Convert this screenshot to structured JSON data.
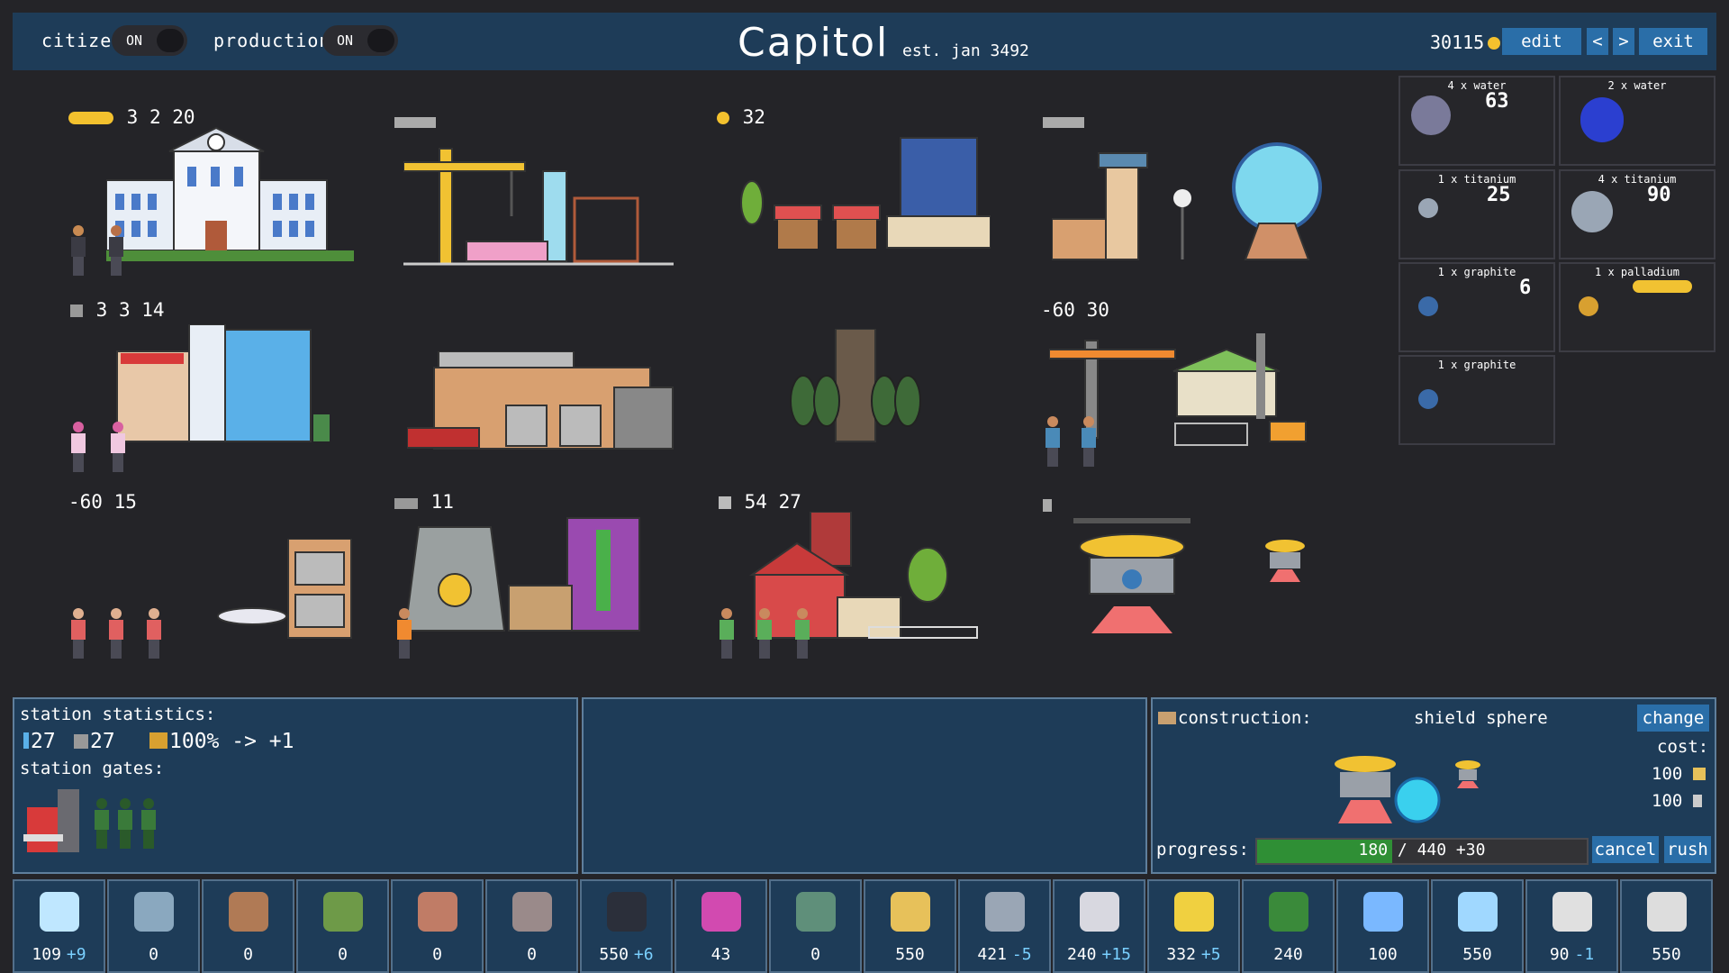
{
  "topbar": {
    "citizen_label": "citizen",
    "citizen_toggle": "ON",
    "production_label": "production",
    "production_toggle": "ON",
    "title": "Capitol",
    "subtitle": "est. jan 3492",
    "coins": "30115",
    "edit_label": "edit",
    "prev_label": "<",
    "next_label": ">",
    "exit_label": "exit"
  },
  "buildings": {
    "capitol_stats": "3  2  20",
    "market_stats": "32",
    "ad_agency_stats": "3  3  14",
    "construction_site_stats": "-60 30",
    "hangar_stats": "-60  15",
    "power_plant_stats": "11",
    "farm_stats": "54 27"
  },
  "resource_cards": [
    {
      "title": "4 x water",
      "value": "63"
    },
    {
      "title": "2 x water",
      "value": ""
    },
    {
      "title": "1 x titanium",
      "value": "25"
    },
    {
      "title": "4 x titanium",
      "value": "90"
    },
    {
      "title": "1 x graphite",
      "value": "6"
    },
    {
      "title": "1 x palladium",
      "value": ""
    },
    {
      "title": "1 x graphite",
      "value": ""
    }
  ],
  "station": {
    "heading": "station statistics:",
    "citizens": "27",
    "housing": "27",
    "approval": "100% -> +1",
    "gates_heading": "station gates:"
  },
  "construction": {
    "label": "construction:",
    "name": "shield sphere",
    "change_label": "change",
    "cost_label": "cost:",
    "cost1": "100",
    "cost2": "100",
    "progress_label": "progress:",
    "progress_text": "180 / 440 +30",
    "progress_fraction": 0.41,
    "cancel_label": "cancel",
    "rush_label": "rush"
  },
  "resources": [
    {
      "name": "water",
      "value": "109",
      "delta": "+9",
      "color": "#bfe7ff"
    },
    {
      "name": "blueprint",
      "value": "0",
      "delta": "",
      "color": "#8aa8bf"
    },
    {
      "name": "ore",
      "value": "0",
      "delta": "",
      "color": "#b07a55"
    },
    {
      "name": "bottles",
      "value": "0",
      "delta": "",
      "color": "#6e9a48"
    },
    {
      "name": "building",
      "value": "0",
      "delta": "",
      "color": "#c07c66"
    },
    {
      "name": "circuit",
      "value": "0",
      "delta": "",
      "color": "#9a8a8a"
    },
    {
      "name": "graphite",
      "value": "550",
      "delta": "+6",
      "color": "#2b2f3a"
    },
    {
      "name": "mesh",
      "value": "43",
      "delta": "",
      "color": "#d24ab0"
    },
    {
      "name": "canister",
      "value": "0",
      "delta": "",
      "color": "#5f8f7a"
    },
    {
      "name": "sponge",
      "value": "550",
      "delta": "",
      "color": "#e7c15a"
    },
    {
      "name": "titanium",
      "value": "421",
      "delta": "-5",
      "color": "#9aa6b5"
    },
    {
      "name": "rocket",
      "value": "240",
      "delta": "+15",
      "color": "#d8d8e0"
    },
    {
      "name": "crystal",
      "value": "332",
      "delta": "+5",
      "color": "#f0d040"
    },
    {
      "name": "chip",
      "value": "240",
      "delta": "",
      "color": "#3a8a3a"
    },
    {
      "name": "gem",
      "value": "100",
      "delta": "",
      "color": "#7ab8ff"
    },
    {
      "name": "atom",
      "value": "550",
      "delta": "",
      "color": "#a0d8ff"
    },
    {
      "name": "battery",
      "value": "90",
      "delta": "-1",
      "color": "#e0e0e0"
    },
    {
      "name": "antenna",
      "value": "550",
      "delta": "",
      "color": "#dddddd"
    }
  ]
}
